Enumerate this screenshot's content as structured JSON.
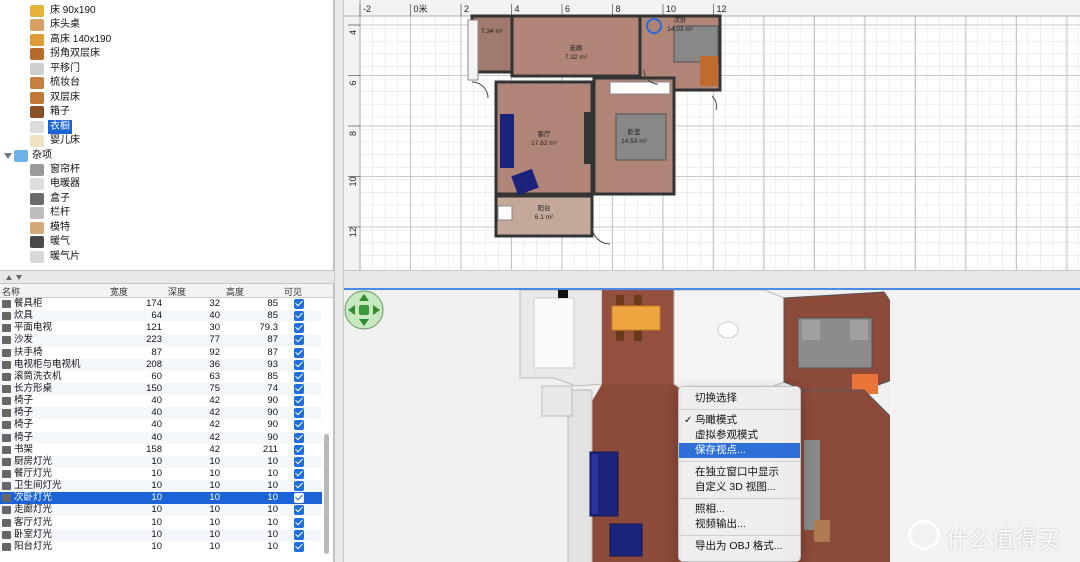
{
  "catalog": {
    "items": [
      {
        "label": "床 90x190",
        "color": "#e4b43a",
        "folder": false,
        "selected": false
      },
      {
        "label": "床头桌",
        "color": "#d9a065",
        "folder": false,
        "selected": false
      },
      {
        "label": "高床 140x190",
        "color": "#e19a3a",
        "folder": false,
        "selected": false
      },
      {
        "label": "拐角双层床",
        "color": "#b56b2c",
        "folder": false,
        "selected": false
      },
      {
        "label": "平移门",
        "color": "#cfcfcf",
        "folder": false,
        "selected": false
      },
      {
        "label": "梳妆台",
        "color": "#c68040",
        "folder": false,
        "selected": false
      },
      {
        "label": "双层床",
        "color": "#c07838",
        "folder": false,
        "selected": false
      },
      {
        "label": "箱子",
        "color": "#8a5028",
        "folder": false,
        "selected": false
      },
      {
        "label": "衣橱",
        "color": "#dcdcdc",
        "folder": false,
        "selected": true
      },
      {
        "label": "婴儿床",
        "color": "#efe2c6",
        "folder": false,
        "selected": false
      },
      {
        "label": "杂项",
        "color": "#6fb3e6",
        "folder": true,
        "selected": false
      },
      {
        "label": "窗帘杆",
        "color": "#9a9a9a",
        "folder": false,
        "selected": false
      },
      {
        "label": "电暖器",
        "color": "#dddddd",
        "folder": false,
        "selected": false
      },
      {
        "label": "盒子",
        "color": "#6b6b6b",
        "folder": false,
        "selected": false
      },
      {
        "label": "栏杆",
        "color": "#bdbdbd",
        "folder": false,
        "selected": false
      },
      {
        "label": "模特",
        "color": "#d4a878",
        "folder": false,
        "selected": false
      },
      {
        "label": "暖气",
        "color": "#4a4a4a",
        "folder": false,
        "selected": false
      },
      {
        "label": "暖气片",
        "color": "#d8d8d8",
        "folder": false,
        "selected": false
      }
    ]
  },
  "furniture": {
    "columns": {
      "name": "名称",
      "width": "宽度",
      "depth": "深度",
      "height": "高度",
      "visible": "可见"
    },
    "rows": [
      {
        "name": "餐具柜",
        "width": "174",
        "depth": "32",
        "height": "85",
        "visible": true,
        "selected": false
      },
      {
        "name": "炊具",
        "width": "64",
        "depth": "40",
        "height": "85",
        "visible": true,
        "selected": false
      },
      {
        "name": "平面电视",
        "width": "121",
        "depth": "30",
        "height": "79.3",
        "visible": true,
        "selected": false
      },
      {
        "name": "沙发",
        "width": "223",
        "depth": "77",
        "height": "87",
        "visible": true,
        "selected": false
      },
      {
        "name": "扶手椅",
        "width": "87",
        "depth": "92",
        "height": "87",
        "visible": true,
        "selected": false
      },
      {
        "name": "电视柜与电视机",
        "width": "208",
        "depth": "36",
        "height": "93",
        "visible": true,
        "selected": false
      },
      {
        "name": "滚筒洗衣机",
        "width": "60",
        "depth": "63",
        "height": "85",
        "visible": true,
        "selected": false
      },
      {
        "name": "长方形桌",
        "width": "150",
        "depth": "75",
        "height": "74",
        "visible": true,
        "selected": false
      },
      {
        "name": "椅子",
        "width": "40",
        "depth": "42",
        "height": "90",
        "visible": true,
        "selected": false
      },
      {
        "name": "椅子",
        "width": "40",
        "depth": "42",
        "height": "90",
        "visible": true,
        "selected": false
      },
      {
        "name": "椅子",
        "width": "40",
        "depth": "42",
        "height": "90",
        "visible": true,
        "selected": false
      },
      {
        "name": "椅子",
        "width": "40",
        "depth": "42",
        "height": "90",
        "visible": true,
        "selected": false
      },
      {
        "name": "书架",
        "width": "158",
        "depth": "42",
        "height": "211",
        "visible": true,
        "selected": false
      },
      {
        "name": "厨房灯光",
        "width": "10",
        "depth": "10",
        "height": "10",
        "visible": true,
        "selected": false
      },
      {
        "name": "餐厅灯光",
        "width": "10",
        "depth": "10",
        "height": "10",
        "visible": true,
        "selected": false
      },
      {
        "name": "卫生间灯光",
        "width": "10",
        "depth": "10",
        "height": "10",
        "visible": true,
        "selected": false
      },
      {
        "name": "次卧灯光",
        "width": "10",
        "depth": "10",
        "height": "10",
        "visible": true,
        "selected": true
      },
      {
        "name": "走廊灯光",
        "width": "10",
        "depth": "10",
        "height": "10",
        "visible": true,
        "selected": false
      },
      {
        "name": "客厅灯光",
        "width": "10",
        "depth": "10",
        "height": "10",
        "visible": true,
        "selected": false
      },
      {
        "name": "卧室灯光",
        "width": "10",
        "depth": "10",
        "height": "10",
        "visible": true,
        "selected": false
      },
      {
        "name": "阳台灯光",
        "width": "10",
        "depth": "10",
        "height": "10",
        "visible": true,
        "selected": false
      }
    ]
  },
  "plan": {
    "ruler_top": [
      "-2",
      "0米",
      "2",
      "4",
      "6",
      "8",
      "10",
      "12"
    ],
    "ruler_left": [
      "4",
      "6",
      "8",
      "10",
      "12"
    ],
    "rooms": [
      {
        "name": "",
        "area": "7.34 m²"
      },
      {
        "name": "走廊",
        "area": "7.32 m²"
      },
      {
        "name": "次卧",
        "area": "14.03 m²"
      },
      {
        "name": "客厅",
        "area": "17.62 m²"
      },
      {
        "name": "卧室",
        "area": "14.53 m²"
      },
      {
        "name": "阳台",
        "area": "6.1 m²"
      }
    ]
  },
  "context_menu": {
    "items": [
      {
        "label": "切换选择",
        "checked": false,
        "highlight": false,
        "sep_after": true
      },
      {
        "label": "鸟瞰模式",
        "checked": true,
        "highlight": false,
        "sep_after": false
      },
      {
        "label": "虚拟参观模式",
        "checked": false,
        "highlight": false,
        "sep_after": false
      },
      {
        "label": "保存视点...",
        "checked": false,
        "highlight": true,
        "sep_after": true
      },
      {
        "label": "在独立窗口中显示",
        "checked": false,
        "highlight": false,
        "sep_after": false
      },
      {
        "label": "自定义 3D 视图...",
        "checked": false,
        "highlight": false,
        "sep_after": true
      },
      {
        "label": "照相...",
        "checked": false,
        "highlight": false,
        "sep_after": false
      },
      {
        "label": "视频输出...",
        "checked": false,
        "highlight": false,
        "sep_after": true
      },
      {
        "label": "导出为 OBJ 格式...",
        "checked": false,
        "highlight": false,
        "sep_after": false
      }
    ]
  },
  "watermark": {
    "text": "什么值得买"
  },
  "colors": {
    "accent": "#1d63d8",
    "floor": "#8b4a3a",
    "sofa": "#1b237a",
    "wall": "#3a3a3a"
  }
}
